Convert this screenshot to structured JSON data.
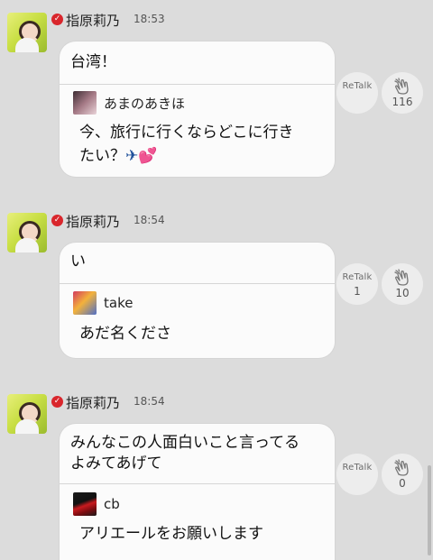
{
  "messages": [
    {
      "author": "指原莉乃",
      "time": "18:53",
      "text_lines": [
        "台湾！"
      ],
      "quote": {
        "author": "あまのあきほ",
        "text_lines": [
          "今、旅行に行くならどこに行き",
          "たい？"
        ],
        "emoji": "✈💕"
      },
      "retalk": {
        "label": "ReTalk",
        "count": ""
      },
      "clap": {
        "count": "116"
      }
    },
    {
      "author": "指原莉乃",
      "time": "18:54",
      "text_lines": [
        "い"
      ],
      "quote": {
        "author": "take",
        "text_lines": [
          "あだ名くださ"
        ],
        "emoji": ""
      },
      "retalk": {
        "label": "ReTalk",
        "count": "1"
      },
      "clap": {
        "count": "10"
      }
    },
    {
      "author": "指原莉乃",
      "time": "18:54",
      "text_lines": [
        "みんなこの人面白いこと言ってる",
        "よみてあげて"
      ],
      "quote": {
        "author": "cb",
        "text_lines": [
          "アリエールをお願いします"
        ],
        "emoji": ""
      },
      "retalk": {
        "label": "ReTalk",
        "count": ""
      },
      "clap": {
        "count": "0"
      }
    }
  ],
  "icons": {
    "verified": "check-badge-icon",
    "clap": "clapping-hands-icon"
  },
  "colors": {
    "background": "#dcdcdc",
    "bubble": "#fbfbfb",
    "verified_badge": "#d9262c",
    "action_circle": "#ededed"
  }
}
